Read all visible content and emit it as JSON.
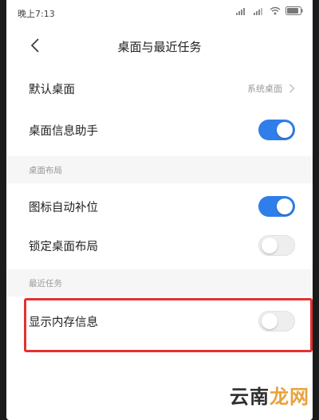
{
  "status_bar": {
    "time": "晚上7:13"
  },
  "header": {
    "title": "桌面与最近任务"
  },
  "rows": {
    "default_desktop": {
      "label": "默认桌面",
      "value": "系统桌面"
    },
    "desktop_assistant": {
      "label": "桌面信息助手",
      "toggle": "on"
    },
    "icon_autofill": {
      "label": "图标自动补位",
      "toggle": "on"
    },
    "lock_layout": {
      "label": "锁定桌面布局",
      "toggle": "off"
    },
    "show_memory": {
      "label": "显示内存信息",
      "toggle": "off"
    }
  },
  "sections": {
    "desktop_layout": "桌面布局",
    "recent_tasks": "最近任务"
  },
  "watermark": {
    "part1": "云南",
    "part2": "龙网"
  },
  "colors": {
    "accent": "#2f7ee9",
    "highlight": "#e53030",
    "watermark_accent": "#e8a23a"
  }
}
